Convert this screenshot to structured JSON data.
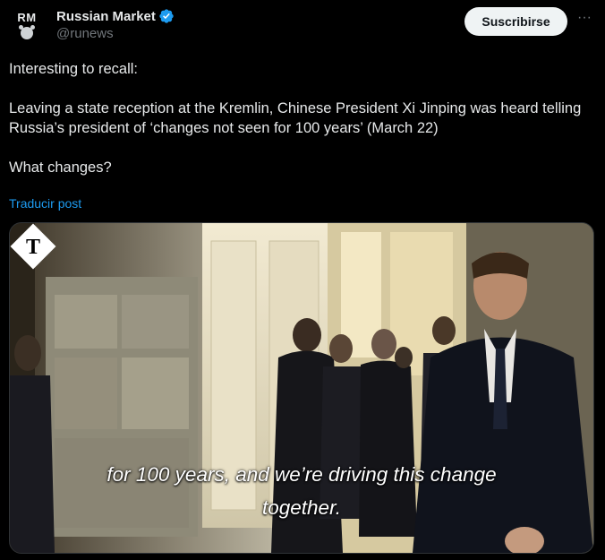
{
  "author": {
    "display_name": "Russian Market",
    "handle": "@runews",
    "avatar_text": "RM",
    "verified_color": "#1d9bf0"
  },
  "actions": {
    "subscribe_label": "Suscribirse",
    "more_label": "···"
  },
  "post": {
    "text": "Interesting to recall:\n\nLeaving a state reception at the Kremlin, Chinese President Xi Jinping was heard telling Russia’s president of ‘changes not seen for 100 years’ (March 22)\n\nWhat changes?",
    "translate_label": "Traducir post"
  },
  "media": {
    "type": "video",
    "caption_line1": "for 100 years, and we’re driving this change",
    "caption_line2": "together.",
    "watermark": "telegraph-logo"
  },
  "colors": {
    "background": "#000000",
    "text": "#e7e9ea",
    "secondary": "#71767b",
    "link": "#1d9bf0"
  }
}
